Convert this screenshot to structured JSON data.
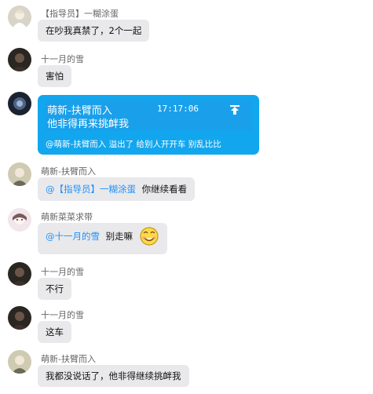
{
  "messages": [
    {
      "sender": "【指导员】一糊涂蛋",
      "text": "在吵我真禁了，2个一起"
    },
    {
      "sender": "十一月的雪",
      "text": "害怕"
    },
    {
      "card": {
        "name": "萌新-扶臂而入",
        "time": "17:17:06",
        "text": "他非得再来挑衅我",
        "footer": "@萌新-扶臂而入 溢出了 给别人开开车 别乱比比"
      }
    },
    {
      "sender": "萌新-扶臂而入",
      "mention": "@【指导员】一糊涂蛋",
      "text": "你继续看看"
    },
    {
      "sender": "萌新菜菜求带",
      "mention": "@十一月的雪",
      "text": "别走嘛"
    },
    {
      "sender": "十一月的雪",
      "text": "不行"
    },
    {
      "sender": "十一月的雪",
      "text": "这车"
    },
    {
      "sender": "萌新-扶臂而入",
      "text": "我都没说话了，他非得继续挑衅我"
    }
  ],
  "icons": {
    "share": "share-up-arrow-icon",
    "emoji": "smiling-face-emoji-icon"
  },
  "colors": {
    "card_blue": "#12a6ee",
    "bubble_gray": "#e9e9eb",
    "mention_blue": "#1e90ff"
  }
}
